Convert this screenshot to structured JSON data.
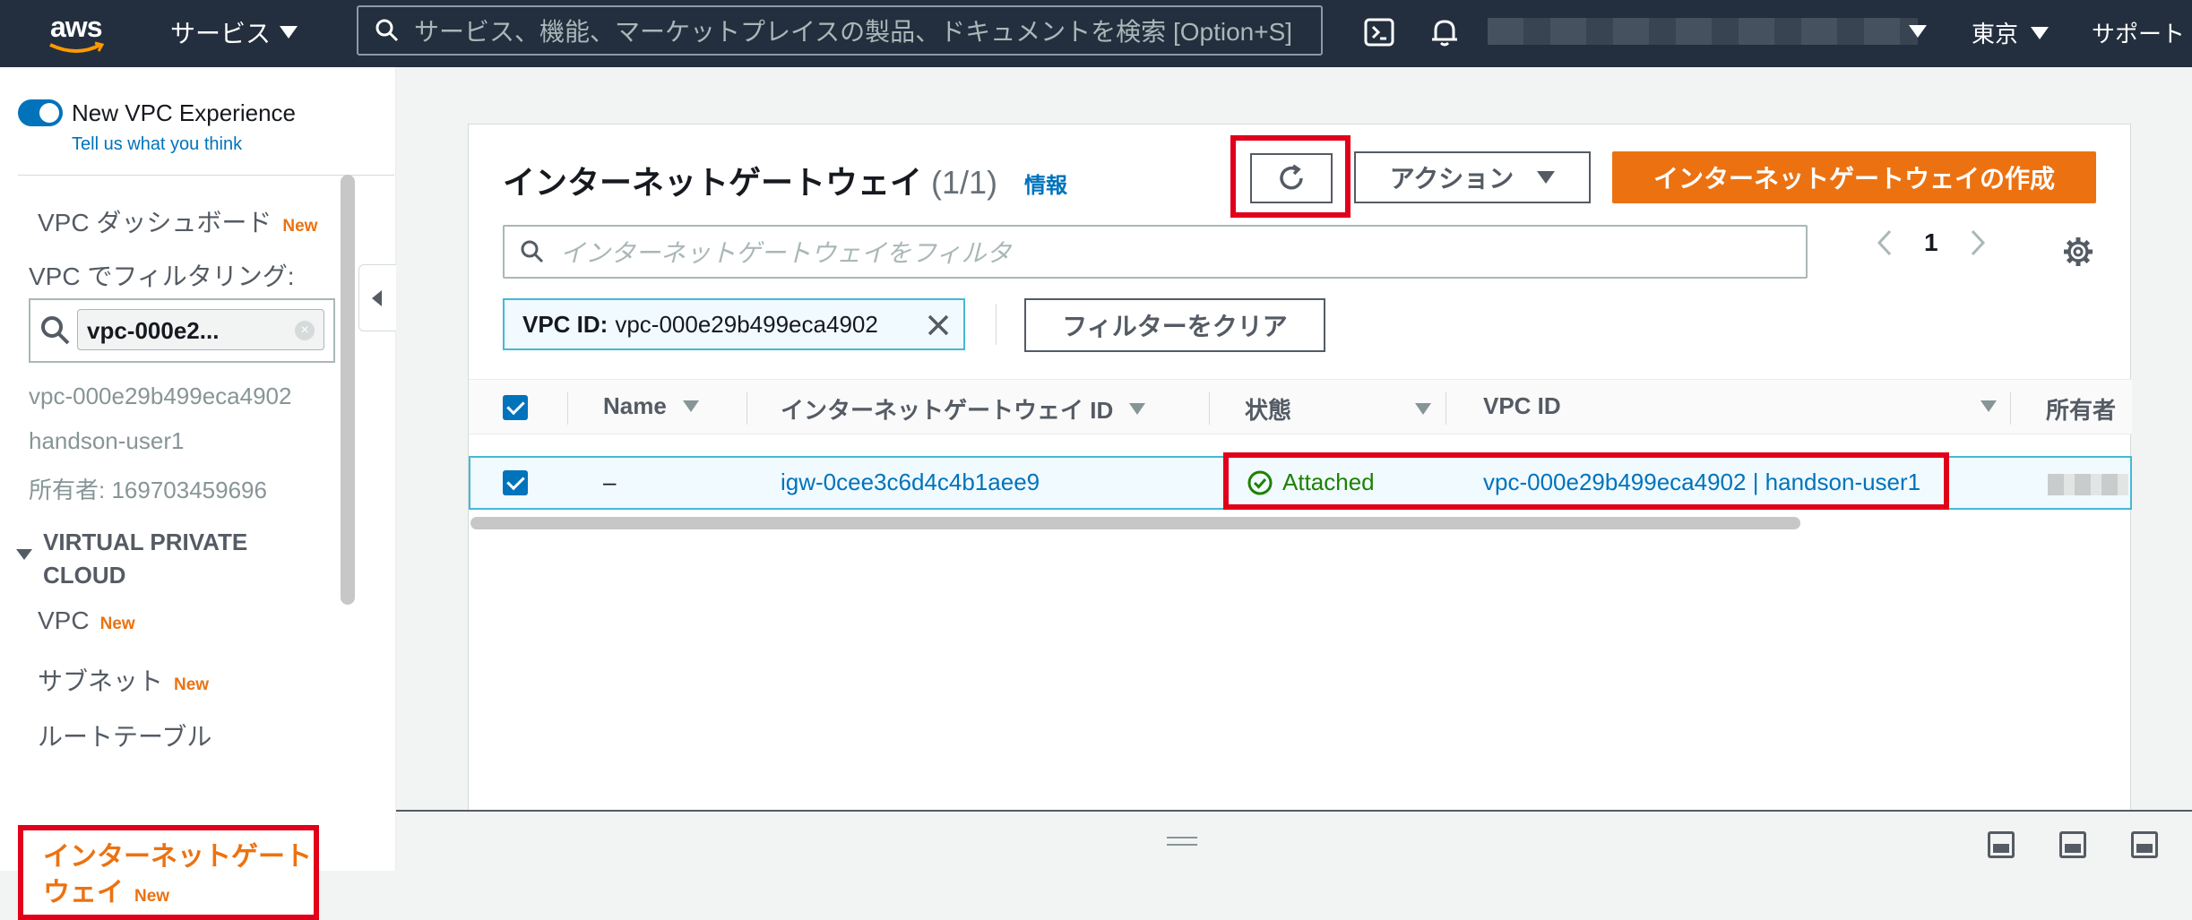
{
  "topbar": {
    "logo_text": "aws",
    "services_label": "サービス",
    "search_placeholder": "サービス、機能、マーケットプレイスの製品、ドキュメントを検索 [Option+S]",
    "region_label": "東京",
    "support_label": "サポート"
  },
  "sidebar": {
    "toggle_label": "New VPC Experience",
    "tell_us_link": "Tell us what you think",
    "dashboard_label": "VPC ダッシュボード",
    "new_badge": "New",
    "filter_label": "VPC でフィルタリング:",
    "filter_chip_value": "vpc-000e2...",
    "vpc_id": "vpc-000e29b499eca4902",
    "vpc_name": "handson-user1",
    "owner": "所有者: 169703459696",
    "section_title_1": "VIRTUAL PRIVATE",
    "section_title_2": "CLOUD",
    "items": [
      {
        "label": "VPC"
      },
      {
        "label": "サブネット"
      },
      {
        "label": "ルートテーブル"
      }
    ],
    "active_item_line1": "インターネットゲート",
    "active_item_line2": "ウェイ"
  },
  "panel": {
    "title": "インターネットゲートウェイ",
    "count": "(1/1)",
    "info_link": "情報",
    "actions_label": "アクション",
    "create_label": "インターネットゲートウェイの作成",
    "filter_placeholder": "インターネットゲートウェイをフィルタ",
    "page_number": "1",
    "token_key": "VPC ID:",
    "token_value": "vpc-000e29b499eca4902",
    "clear_filters_label": "フィルターをクリア"
  },
  "table": {
    "columns": [
      "Name",
      "インターネットゲートウェイ ID",
      "状態",
      "VPC ID",
      "所有者"
    ],
    "rows": [
      {
        "name": "–",
        "igw_id": "igw-0cee3c6d4c4b1aee9",
        "state": "Attached",
        "vpc": "vpc-000e29b499eca4902 | handson-user1"
      }
    ]
  },
  "colors": {
    "topbar": "#232f3e",
    "accent_orange": "#ec7211",
    "link_blue": "#0073bb",
    "highlight_red": "#e1001a",
    "status_green": "#1d8102"
  }
}
